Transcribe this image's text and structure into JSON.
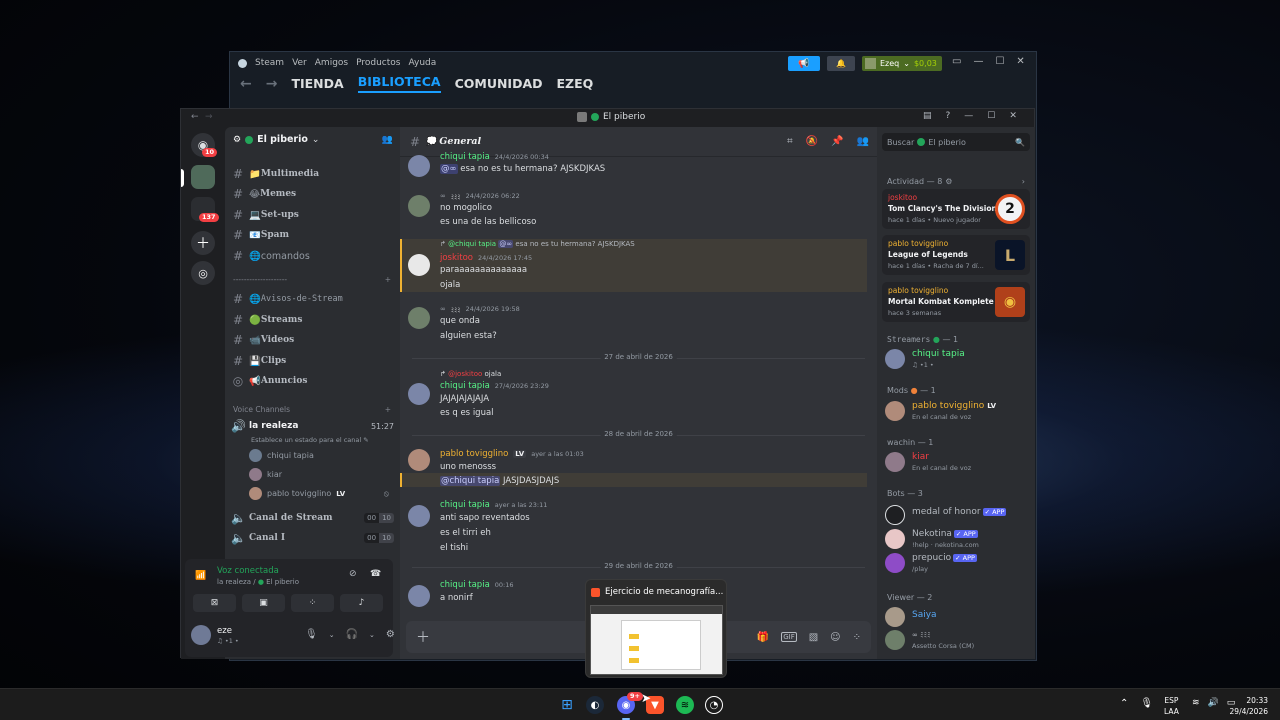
{
  "steam": {
    "menu": [
      "Steam",
      "Ver",
      "Amigos",
      "Productos",
      "Ayuda"
    ],
    "nav": [
      "TIENDA",
      "BIBLIOTECA",
      "COMUNIDAD",
      "EZEQ"
    ],
    "user": "Ezeq",
    "balance": "$0,03"
  },
  "discord": {
    "title": "El piberio",
    "server_name": "El piberio",
    "server_badges": {
      "home": "10",
      "group": "137"
    },
    "channels": [
      {
        "name": "Multimedia",
        "emoji": "📁"
      },
      {
        "name": "Memes",
        "emoji": "😂"
      },
      {
        "name": "Set-ups",
        "emoji": "💻"
      },
      {
        "name": "Spam",
        "emoji": "📧"
      },
      {
        "name": "comandos",
        "emoji": "🌐"
      }
    ],
    "separator": "--------------------",
    "channels2": [
      {
        "name": "Avisos-de-Stream",
        "emoji": "🌐"
      },
      {
        "name": "Streams",
        "emoji": "🟢"
      },
      {
        "name": "Videos",
        "emoji": "📹"
      },
      {
        "name": "Clips",
        "emoji": "💾"
      },
      {
        "name": "Anuncios",
        "emoji": "📢"
      }
    ],
    "voice_category": "Voice Channels",
    "voice_channel": {
      "name": "la realeza",
      "time": "51:27",
      "status_placeholder": "Establece un estado para el canal"
    },
    "voice_users": [
      "chiqui tapia",
      "kiar",
      "pablo tovigglino"
    ],
    "voice_user_badge": "LV",
    "other_voice": [
      {
        "name": "Canal de Stream",
        "count": "00",
        "limit": "10"
      },
      {
        "name": "Canal I",
        "count": "00",
        "limit": "10"
      }
    ],
    "voice_panel": {
      "title": "Voz conectada",
      "sub": "la realeza / ",
      "server": "El piberio"
    },
    "user": {
      "name": "eze",
      "tag": "♫ •1 •"
    },
    "chat_channel": "General",
    "search_placeholder": "Buscar",
    "search_server": "El piberio",
    "messages": [
      {
        "author": "chiqui tapia",
        "time": "24/4/2026 00:34",
        "mention": "@∞",
        "text": "esa no es tu hermana? AJSKDJKAS"
      },
      {
        "author": "∞",
        "tag": "ﾐﾐﾐ",
        "time": "24/4/2026 06:22",
        "lines": [
          "no mogolico",
          "es una de las bellicoso"
        ]
      },
      {
        "reply_to": "@chiqui tapia",
        "reply_mention": "@∞",
        "reply_text": "esa no es tu hermana? AJSKDJKAS",
        "author": "joskitoo",
        "time": "24/4/2026 17:45",
        "lines": [
          "paraaaaaaaaaaaaaa",
          "ojala"
        ]
      },
      {
        "author": "∞",
        "tag": "ﾐﾐﾐ",
        "time": "24/4/2026 19:58",
        "lines": [
          "que onda",
          "alguien esta?"
        ]
      },
      {
        "divider": "27 de abril de 2026"
      },
      {
        "reply_to": "@joskitoo",
        "reply_text": "ojala",
        "author": "chiqui tapia",
        "time": "27/4/2026 23:29",
        "lines": [
          "JAJAJAJAJAJA",
          "es q es igual"
        ]
      },
      {
        "divider": "28 de abril de 2026"
      },
      {
        "author": "pablo tovigglino",
        "badge": "LV",
        "time": "ayer a las 01:03",
        "lines": [
          "uno menosss"
        ],
        "mention": "@chiqui tapia",
        "mention_text": "JASJDASJDAJS"
      },
      {
        "author": "chiqui tapia",
        "time": "ayer a las 23:11",
        "lines": [
          "anti sapo reventados",
          "es el tirri eh",
          "el tishi"
        ]
      },
      {
        "divider": "29 de abril de 2026"
      },
      {
        "author": "chiqui tapia",
        "time": "00:16",
        "lines": [
          "a nonirf"
        ]
      }
    ],
    "members": {
      "activity_header": "Actividad — 8",
      "activities": [
        {
          "user": "joskitoo",
          "game": "Tom Clancy's The Division 2",
          "info": "hace 1 días",
          "extra": "Nuevo jugador",
          "color": "#f23f43"
        },
        {
          "user": "pablo tovigglino",
          "game": "League of Legends",
          "info": "hace 1 días",
          "extra": "Racha de 7 dí...",
          "color": "#f0b232"
        },
        {
          "user": "pablo tovigglino",
          "game": "Mortal Kombat Komplete ...",
          "info": "hace 3 semanas",
          "extra": "",
          "color": "#f0b232"
        }
      ],
      "groups": [
        {
          "label": "Streamers",
          "count": "— 1"
        },
        {
          "label": "Mods",
          "count": "— 1"
        },
        {
          "label": "wachin — 1",
          "count": ""
        },
        {
          "label": "Bots — 3",
          "count": ""
        },
        {
          "label": "Viewer — 2",
          "count": ""
        }
      ],
      "streamer": {
        "name": "chiqui tapia",
        "status": "♫ •1 •"
      },
      "mod": {
        "name": "pablo tovigglino",
        "badge": "LV",
        "status": "En el canal de voz"
      },
      "wachin": {
        "name": "kiar",
        "status": "En el canal de voz"
      },
      "bots": [
        {
          "name": "medal of honor",
          "tag": "✓ APP",
          "status": ""
        },
        {
          "name": "Nekotina",
          "tag": "✓ APP",
          "status": "!help · nekotina.com"
        },
        {
          "name": "prepucio",
          "tag": "✓ APP",
          "status": "/play"
        }
      ],
      "viewers": [
        {
          "name": "Saiya",
          "status": ""
        },
        {
          "name": "∞",
          "tag": "ﾐﾐﾐ",
          "status": "Assetto Corsa (CM)"
        }
      ]
    },
    "tooltip": "Ejercicio de mecanografía..."
  },
  "taskbar": {
    "lang1": "ESP",
    "lang2": "LAA",
    "time": "20:33",
    "date": "29/4/2026",
    "discord_badge": "9+"
  }
}
